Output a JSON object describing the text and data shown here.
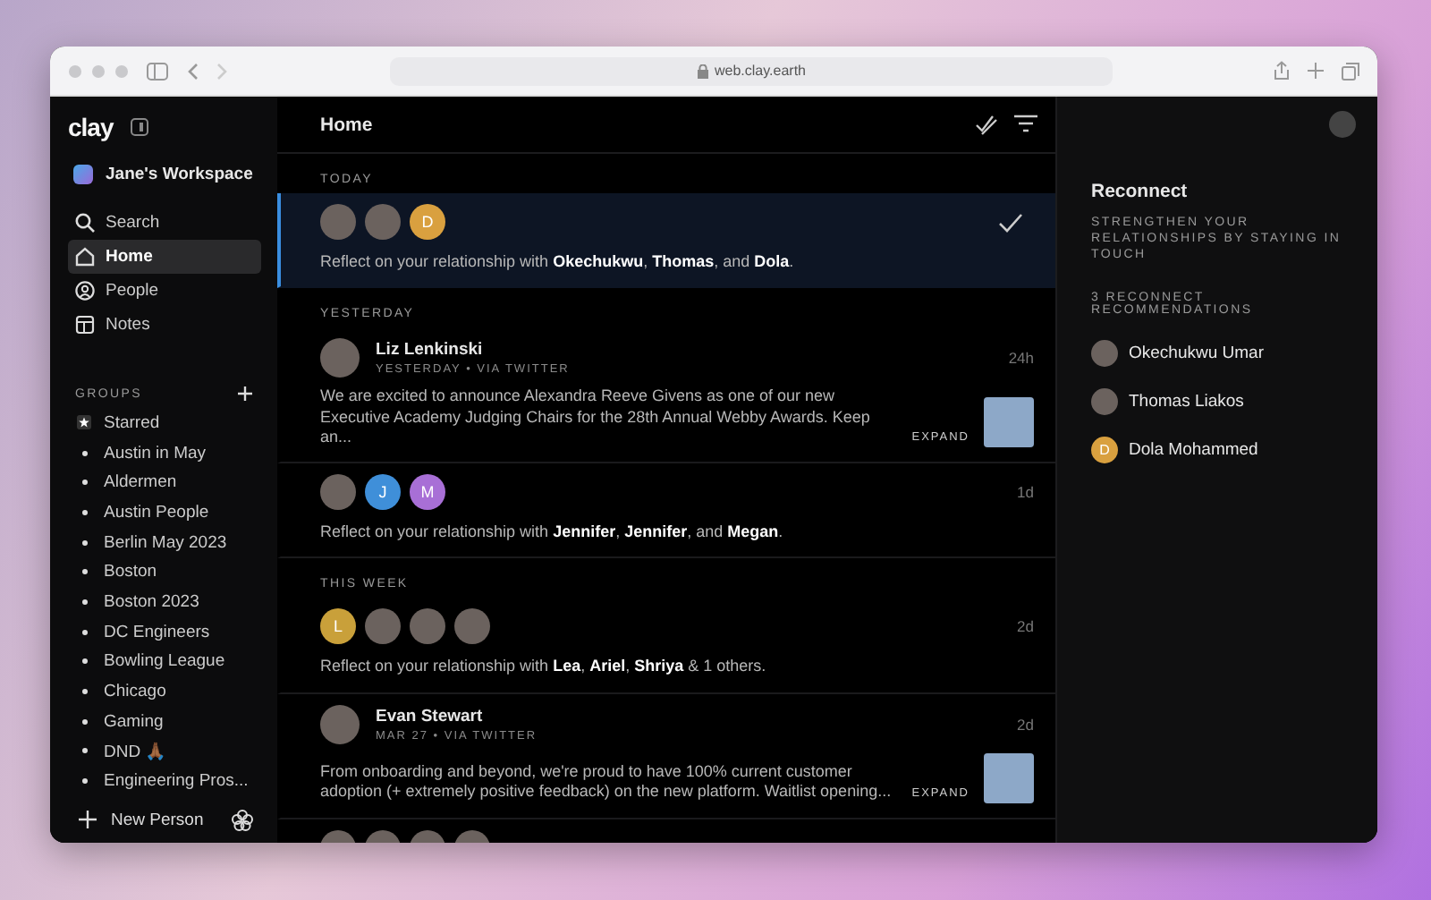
{
  "browser": {
    "url": "web.clay.earth"
  },
  "sidebar": {
    "logo": "clay",
    "workspace": "Jane's Workspace",
    "nav": [
      {
        "label": "Search",
        "kind": "search",
        "selected": false
      },
      {
        "label": "Home",
        "kind": "home",
        "selected": true
      },
      {
        "label": "People",
        "kind": "people",
        "selected": false
      },
      {
        "label": "Notes",
        "kind": "notes",
        "selected": false
      }
    ],
    "groups_title": "GROUPS",
    "groups": [
      {
        "label": "Starred",
        "kind": "star"
      },
      {
        "label": "Austin in May",
        "kind": "bullet"
      },
      {
        "label": "Aldermen",
        "kind": "bullet"
      },
      {
        "label": "Austin People",
        "kind": "bullet"
      },
      {
        "label": "Berlin May 2023",
        "kind": "bullet"
      },
      {
        "label": "Boston",
        "kind": "bullet"
      },
      {
        "label": "Boston 2023",
        "kind": "bullet"
      },
      {
        "label": "DC Engineers",
        "kind": "bullet"
      },
      {
        "label": "Bowling League",
        "kind": "bullet"
      },
      {
        "label": "Chicago",
        "kind": "bullet"
      },
      {
        "label": "Gaming",
        "kind": "bullet"
      },
      {
        "label": "DND 🙏🏾",
        "kind": "bullet"
      },
      {
        "label": "Engineering Pros...",
        "kind": "bullet"
      }
    ],
    "new_person": "New Person"
  },
  "main": {
    "title": "Home",
    "sections": [
      {
        "heading": "TODAY",
        "items": [
          {
            "kind": "reflect",
            "selected": true,
            "avatars": [
              {
                "kind": "photo"
              },
              {
                "kind": "photo"
              },
              {
                "kind": "letter",
                "letter": "D",
                "color": "#d9a03f"
              }
            ],
            "text": "Reflect on your relationship with **Okechukwu**, **Thomas**, and **Dola**.",
            "done": true
          }
        ]
      },
      {
        "heading": "YESTERDAY",
        "items": [
          {
            "kind": "post",
            "selected": false,
            "name": "Liz Lenkinski",
            "meta": "YESTERDAY • VIA TWITTER",
            "time": "24h",
            "text": "We are excited to announce Alexandra Reeve Givens as one of our new Executive Academy Judging Chairs for the 28th Annual Webby Awards.  Keep an...",
            "action": "EXPAND"
          },
          {
            "kind": "reflect",
            "selected": false,
            "time": "1d",
            "avatars": [
              {
                "kind": "photo"
              },
              {
                "kind": "letter",
                "letter": "J",
                "color": "#3f8fd9"
              },
              {
                "kind": "letter",
                "letter": "M",
                "color": "#a86fd6"
              }
            ],
            "text": "Reflect on your relationship with **Jennifer**, **Jennifer**, and **Megan**."
          }
        ]
      },
      {
        "heading": "THIS WEEK",
        "items": [
          {
            "kind": "reflect",
            "selected": false,
            "time": "2d",
            "avatars": [
              {
                "kind": "letter",
                "letter": "L",
                "color": "#c9a03a"
              },
              {
                "kind": "photo"
              },
              {
                "kind": "photo"
              },
              {
                "kind": "photo"
              }
            ],
            "text": "Reflect on your relationship with **Lea**, **Ariel**, **Shriya** & 1 others."
          },
          {
            "kind": "post",
            "selected": false,
            "name": "Evan Stewart",
            "meta": "MAR 27 • VIA TWITTER",
            "time": "2d",
            "text": "From onboarding and beyond, we're proud to have 100% current customer adoption (+ extremely positive feedback) on the new platform.  Waitlist opening...",
            "action": "EXPAND"
          },
          {
            "kind": "reflect",
            "selected": false,
            "avatars": [
              {
                "kind": "photo"
              },
              {
                "kind": "photo"
              },
              {
                "kind": "photo"
              },
              {
                "kind": "photo"
              }
            ]
          }
        ]
      }
    ]
  },
  "panel": {
    "title": "Reconnect",
    "subtitle": "STRENGTHEN YOUR RELATIONSHIPS BY STAYING IN TOUCH",
    "count": "3 RECONNECT RECOMMENDATIONS",
    "people": [
      {
        "name": "Okechukwu Umar",
        "avatar": {
          "kind": "photo"
        }
      },
      {
        "name": "Thomas Liakos",
        "avatar": {
          "kind": "photo"
        }
      },
      {
        "name": "Dola Mohammed",
        "avatar": {
          "kind": "letter",
          "letter": "D",
          "color": "#d9a03f"
        }
      }
    ]
  }
}
